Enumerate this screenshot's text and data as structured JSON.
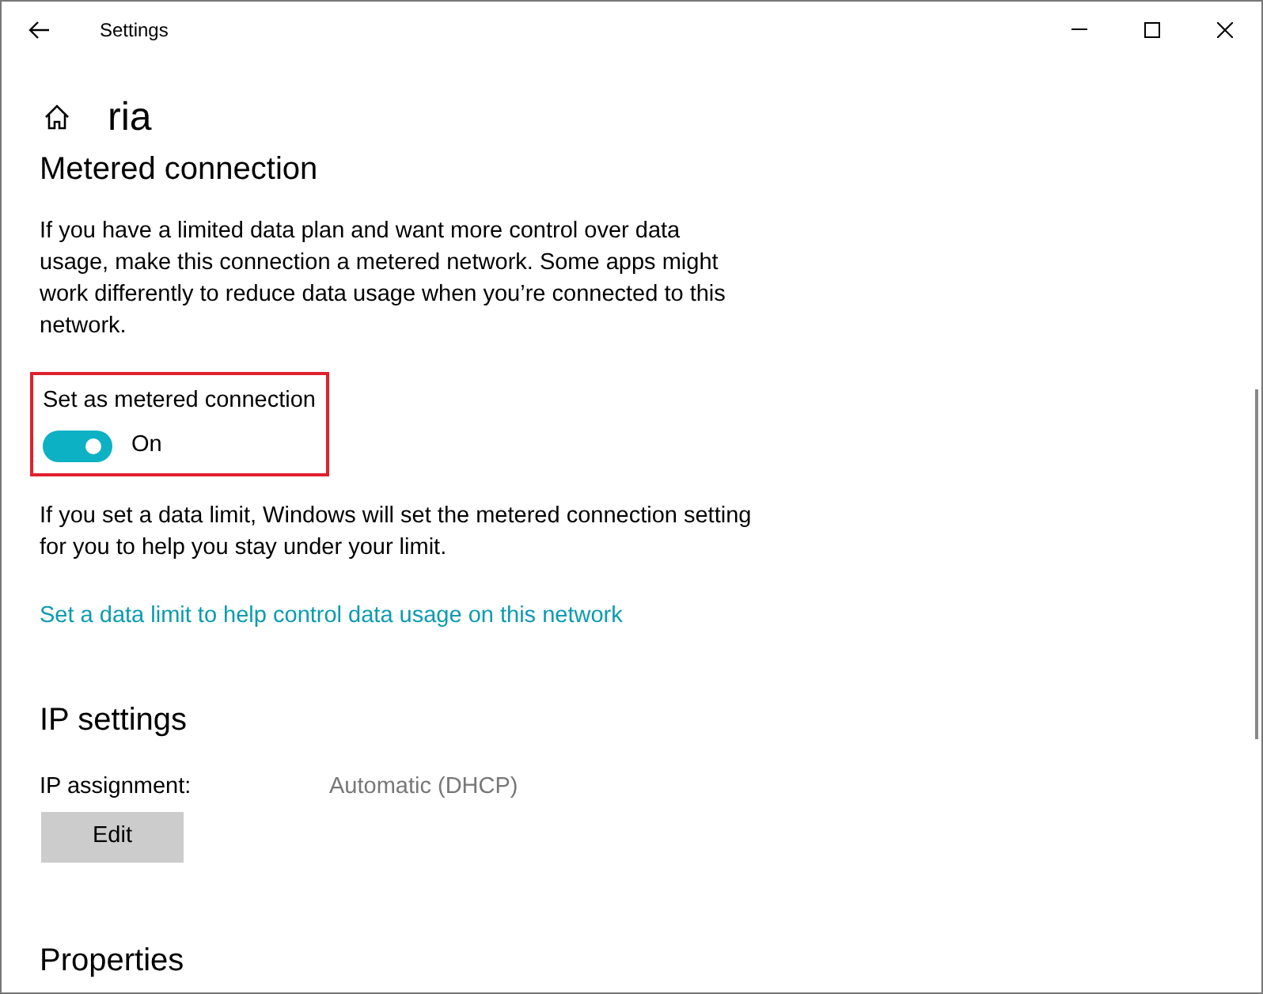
{
  "window": {
    "title": "Settings"
  },
  "page": {
    "title": "ria"
  },
  "metered": {
    "heading": "Metered connection",
    "description": "If you have a limited data plan and want more control over data usage, make this connection a metered network. Some apps might work differently to reduce data usage when you’re connected to this network.",
    "toggle": {
      "label": "Set as metered connection",
      "on": true,
      "state_text": "On",
      "highlighted": true
    },
    "note": "If you set a data limit, Windows will set the metered connection setting for you to help you stay under your limit.",
    "link": "Set a data limit to help control data usage on this network"
  },
  "ip_settings": {
    "heading": "IP settings",
    "label": "IP assignment:",
    "value": "Automatic (DHCP)",
    "button": "Edit"
  },
  "properties": {
    "heading": "Properties"
  }
}
